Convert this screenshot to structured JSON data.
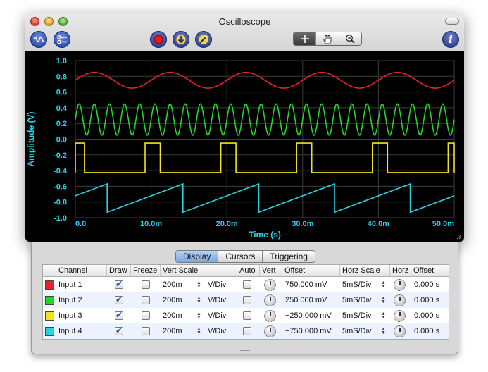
{
  "window": {
    "title": "Oscilloscope"
  },
  "toolbar": {
    "left_icons": [
      "waveform-icon",
      "channel-settings-icon"
    ],
    "center_icons": [
      "record-icon",
      "trigger-icon",
      "probe-icon"
    ],
    "tools": [
      {
        "name": "crosshair-icon",
        "active": true
      },
      {
        "name": "hand-icon",
        "active": false
      },
      {
        "name": "zoom-icon",
        "active": false
      }
    ],
    "info_label": "i"
  },
  "chart_data": {
    "type": "line",
    "xlabel": "Time (s)",
    "ylabel": "Amplitude (V)",
    "xlim": [
      0,
      0.05
    ],
    "ylim": [
      -1.0,
      1.0
    ],
    "x_ticks": [
      "0.0",
      "10.0m",
      "20.0m",
      "30.0m",
      "40.0m",
      "50.0m"
    ],
    "y_ticks": [
      "1.0",
      "0.8",
      "0.6",
      "0.4",
      "0.2",
      "0.0",
      "-0.2",
      "-0.4",
      "-0.6",
      "-0.8",
      "-1.0"
    ],
    "grid": true,
    "series": [
      {
        "color": "#e8202a",
        "shape": "sine",
        "offset": 0.75,
        "amplitude": 0.1,
        "period": 0.01
      },
      {
        "color": "#22d62a",
        "shape": "sine",
        "offset": 0.25,
        "amplitude": 0.2,
        "period": 0.002
      },
      {
        "color": "#f2e31d",
        "shape": "square",
        "low": -0.425,
        "high": -0.05,
        "period": 0.01,
        "pulse_start": 0.0092,
        "pulse_width": 0.002
      },
      {
        "color": "#27d4e0",
        "shape": "sawtooth",
        "low": -0.93,
        "high": -0.57,
        "period": 0.01,
        "reset_at": 0.0042
      }
    ]
  },
  "tabs": [
    "Display",
    "Cursors",
    "Triggering"
  ],
  "active_tab": "Display",
  "table": {
    "headers": {
      "channel": "Channel",
      "draw": "Draw",
      "freeze": "Freeze",
      "vert_scale": "Vert Scale",
      "auto": "Auto",
      "vert": "Vert",
      "offset": "Offset",
      "horz_scale": "Horz Scale",
      "horz": "Horz",
      "horz_offset": "Offset"
    },
    "rows": [
      {
        "color": "#e8202a",
        "channel": "Input 1",
        "draw": true,
        "freeze": false,
        "vert_scale": "200m",
        "unit": "V/Div",
        "auto": false,
        "offset": "750.000 mV",
        "horz_scale": "5mS/Div",
        "horz_offset": "0.000 s"
      },
      {
        "color": "#22d62a",
        "channel": "Input 2",
        "draw": true,
        "freeze": false,
        "vert_scale": "200m",
        "unit": "V/Div",
        "auto": false,
        "offset": "250.000 mV",
        "horz_scale": "5mS/Div",
        "horz_offset": "0.000 s"
      },
      {
        "color": "#f2e31d",
        "channel": "Input 3",
        "draw": true,
        "freeze": false,
        "vert_scale": "200m",
        "unit": "V/Div",
        "auto": false,
        "offset": "−250.000 mV",
        "horz_scale": "5mS/Div",
        "horz_offset": "0.000 s"
      },
      {
        "color": "#27d4e0",
        "channel": "Input 4",
        "draw": true,
        "freeze": false,
        "vert_scale": "200m",
        "unit": "V/Div",
        "auto": false,
        "offset": "−750.000 mV",
        "horz_scale": "5mS/Div",
        "horz_offset": "0.000 s"
      }
    ]
  }
}
